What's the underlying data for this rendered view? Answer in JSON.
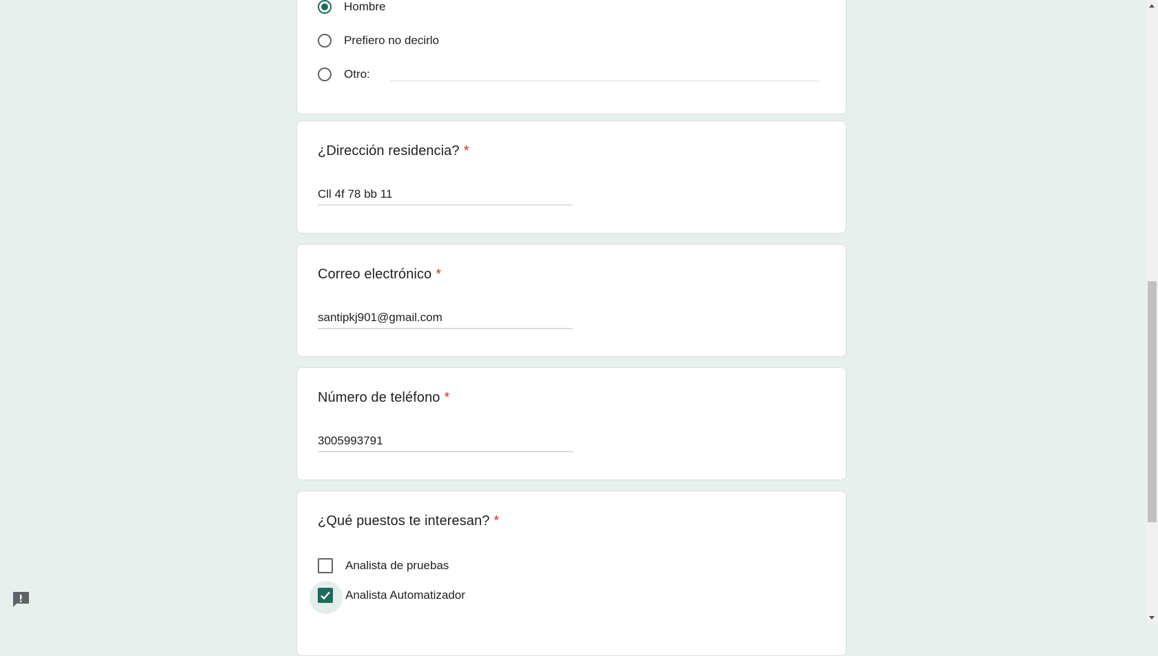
{
  "gender_question": {
    "options": [
      {
        "label": "Hombre",
        "selected": true
      },
      {
        "label": "Prefiero no decirlo",
        "selected": false
      },
      {
        "label": "Otro:",
        "selected": false
      }
    ]
  },
  "address_question": {
    "title": "¿Dirección residencia?",
    "required_mark": "*",
    "value": "Cll 4f 78 bb 11"
  },
  "email_question": {
    "title": "Correo electrónico",
    "required_mark": "*",
    "value": "santipkj901@gmail.com"
  },
  "phone_question": {
    "title": "Número de teléfono",
    "required_mark": "*",
    "value": "3005993791"
  },
  "positions_question": {
    "title": "¿Qué puestos te interesan?",
    "required_mark": "*",
    "options": [
      {
        "label": "Analista de pruebas",
        "checked": false
      },
      {
        "label": "Analista Automatizador",
        "checked": true
      }
    ]
  },
  "colors": {
    "background": "#e8f0ee",
    "accent": "#1e6a5c",
    "required": "#d93025"
  },
  "icons": {
    "feedback": "report-feedback-icon",
    "checkmark": "check-icon"
  }
}
